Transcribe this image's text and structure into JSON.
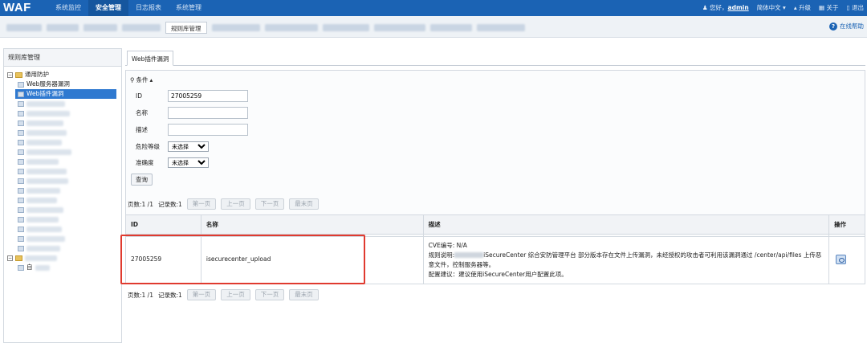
{
  "topbar": {
    "logo": "WAF",
    "nav": [
      "系统监控",
      "安全管理",
      "日志报表",
      "系统管理"
    ],
    "active_index": 1,
    "greeting": "您好，",
    "username": "admin",
    "language": "简体中文 ▾",
    "upgrade": "升级",
    "about": "关于",
    "logout": "退出"
  },
  "subbar": {
    "active_tab": "规则库管理",
    "help": "在线帮助"
  },
  "left": {
    "title": "规则库管理",
    "root": "通用防护",
    "item_web_server": "Web服务器漏洞",
    "item_web_plugin": "Web插件漏洞",
    "item_custom": "自"
  },
  "main": {
    "tab": "Web插件漏洞",
    "filter": {
      "title": "条件",
      "id_label": "ID",
      "id_value": "27005259",
      "name_label": "名称",
      "desc_label": "描述",
      "risk_label": "危险等级",
      "risk_value": "未选择",
      "accuracy_label": "准确度",
      "accuracy_value": "未选择",
      "query_button": "查询"
    },
    "pager": {
      "pages": "页数:1 /1",
      "records": "记录数:1",
      "first": "第一页",
      "prev": "上一页",
      "next": "下一页",
      "last": "最末页"
    },
    "table": {
      "headers": [
        "ID",
        "名称",
        "描述",
        "操作"
      ],
      "row": {
        "id": "27005259",
        "name": "isecurecenter_upload",
        "cve": "CVE编号: N/A",
        "rule_prefix": "规则说明:",
        "rule_text": "iSecureCenter 综合安防管理平台 部分版本存在文件上传漏洞，未经授权的攻击者可利用该漏洞通过 /center/api/files 上传恶意文件，控制服务器等。",
        "advice": "配置建议：建议使用iSecureCenter用户配置此项。"
      }
    }
  }
}
